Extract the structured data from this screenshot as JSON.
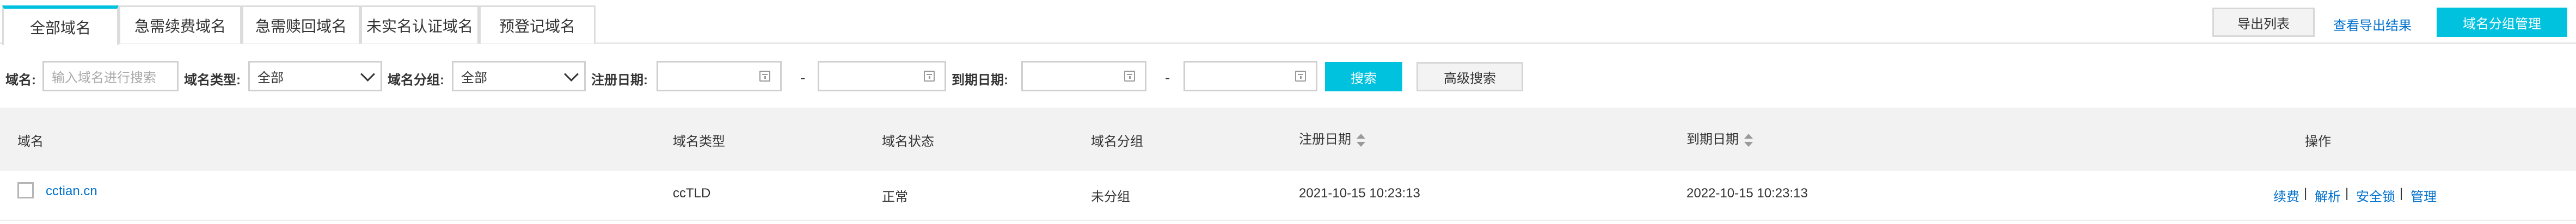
{
  "tabs": [
    {
      "label": "全部域名"
    },
    {
      "label": "急需续费域名"
    },
    {
      "label": "急需赎回域名"
    },
    {
      "label": "未实名认证域名"
    },
    {
      "label": "预登记域名"
    }
  ],
  "toolbar": {
    "export_list": "导出列表",
    "view_export": "查看导出结果",
    "group_manage": "域名分组管理"
  },
  "filters": {
    "domain_label": "域名:",
    "domain_placeholder": "输入域名进行搜索",
    "type_label": "域名类型:",
    "type_value": "全部",
    "group_label": "域名分组:",
    "group_value": "全部",
    "reg_date_label": "注册日期:",
    "reg_start": "",
    "reg_end": "",
    "exp_date_label": "到期日期:",
    "exp_start": "",
    "exp_end": "",
    "range_sep": "-",
    "search_button": "搜索",
    "advanced_button": "高级搜索"
  },
  "table": {
    "headers": {
      "domain": "域名",
      "type": "域名类型",
      "status": "域名状态",
      "group": "域名分组",
      "reg_date": "注册日期",
      "exp_date": "到期日期",
      "actions": "操作"
    },
    "rows": [
      {
        "domain": "cctian.cn",
        "type": "ccTLD",
        "status": "正常",
        "group": "未分组",
        "reg_date": "2021-10-15 10:23:13",
        "exp_date": "2022-10-15 10:23:13",
        "actions": [
          "续费",
          "解析",
          "安全锁",
          "管理"
        ],
        "separator": "|"
      }
    ]
  },
  "colors": {
    "accent": "#00c1de",
    "link": "#0070cc",
    "header_bg": "#f2f2f2"
  }
}
